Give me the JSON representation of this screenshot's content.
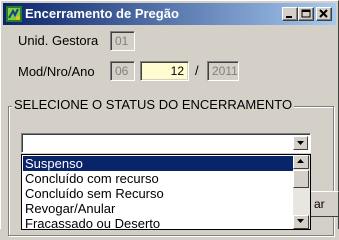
{
  "window": {
    "title": "Encerramento de Pregão",
    "icon": "app-icon",
    "controls": {
      "minimize": "_",
      "maximize": "□",
      "close": "X"
    }
  },
  "form": {
    "unid_gestora": {
      "label": "Unid. Gestora",
      "value": "01"
    },
    "mod_nro_ano": {
      "label": "Mod/Nro/Ano",
      "mod": "06",
      "nro": "12",
      "separator": "/",
      "ano": "2011"
    }
  },
  "status_group": {
    "title": "SELECIONE O STATUS DO ENCERRAMENTO",
    "combo_value": "",
    "options": [
      {
        "label": "Suspenso",
        "selected": true
      },
      {
        "label": "Concluído com recurso",
        "selected": false
      },
      {
        "label": "Concluído sem Recurso",
        "selected": false
      },
      {
        "label": "Revogar/Anular",
        "selected": false
      },
      {
        "label": "Fracassado ou Deserto",
        "selected": false
      }
    ]
  },
  "partial_button": {
    "label": "ar"
  },
  "colors": {
    "titlebar_start": "#0a246a",
    "titlebar_end": "#a6caf0",
    "window_bg": "#d4d0c8",
    "selection": "#0a246a",
    "input_enabled": "#fffdd0"
  }
}
